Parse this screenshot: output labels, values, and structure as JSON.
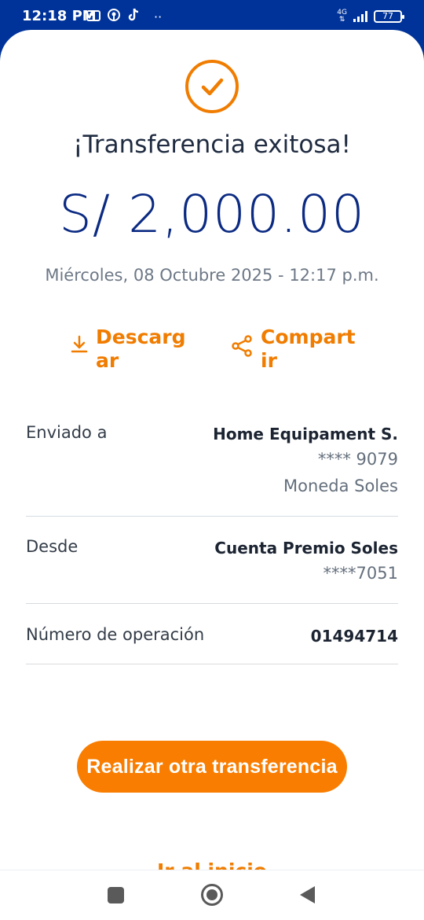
{
  "status_bar": {
    "time": "12:18 PM",
    "network": "4G",
    "battery": "77",
    "icons": [
      "card-icon",
      "podcast-icon",
      "tiktok-icon",
      "more-dots-icon"
    ]
  },
  "receipt": {
    "title": "¡Transferencia exitosa!",
    "amount": "S/ 2,000.00",
    "date": "Miércoles, 08 Octubre 2025 - 12:17 p.m."
  },
  "actions": {
    "download_label": "Descargar",
    "share_label": "Compartir"
  },
  "details": {
    "sent_to": {
      "label": "Enviado a",
      "name": "Home Equipament S.",
      "account": "**** 9079",
      "currency": "Moneda Soles"
    },
    "from": {
      "label": "Desde",
      "account_name": "Cuenta Premio Soles",
      "account_number": "****7051"
    },
    "operation": {
      "label": "Número de operación",
      "value": "01494714"
    }
  },
  "buttons": {
    "another_transfer": "Realizar otra transferencia",
    "go_home": "Ir al inicio"
  },
  "colors": {
    "brand_blue": "#003399",
    "accent_orange": "#f97d00",
    "amount_blue": "#0b2a82"
  }
}
